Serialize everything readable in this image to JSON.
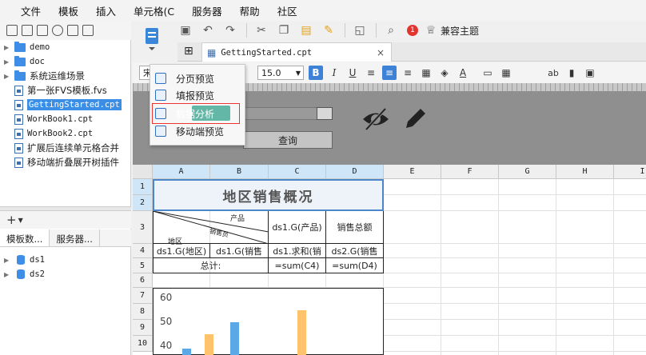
{
  "menu": [
    "文件",
    "模板",
    "插入",
    "单元格(C",
    "服务器",
    "帮助",
    "社区"
  ],
  "left_panel": {
    "tree": [
      {
        "label": "demo",
        "kind": "folder"
      },
      {
        "label": "doc",
        "kind": "folder"
      },
      {
        "label": "系统运维场景",
        "kind": "folder"
      },
      {
        "label": "第一张FVS模板.fvs",
        "kind": "file"
      },
      {
        "label": "GettingStarted.cpt",
        "kind": "file",
        "selected": true
      },
      {
        "label": "WorkBook1.cpt",
        "kind": "file"
      },
      {
        "label": "WorkBook2.cpt",
        "kind": "file"
      },
      {
        "label": "扩展后连续单元格合并",
        "kind": "file"
      },
      {
        "label": "移动端折叠展开树插件",
        "kind": "file"
      }
    ],
    "add_label": "+",
    "tabs": [
      "模板数...",
      "服务器..."
    ],
    "datasets": [
      "ds1",
      "ds2"
    ]
  },
  "toolbar": {
    "badge_count": "1",
    "theme_label": "兼容主题"
  },
  "doc_tab": {
    "label": "GettingStarted.cpt",
    "close": "×"
  },
  "format_bar": {
    "font_name": "宋",
    "font_size": "15.0",
    "bold": "B",
    "text_ab": "ab"
  },
  "preview_menu": {
    "items": [
      "分页预览",
      "填报预览",
      "数据分析",
      "移动端预览"
    ],
    "highlighted": "数据分析"
  },
  "parameter_panel": {
    "query_button": "查询"
  },
  "sheet": {
    "columns": [
      "A",
      "B",
      "C",
      "D",
      "E",
      "F",
      "G",
      "H",
      "I"
    ],
    "rows": [
      "1",
      "2",
      "3",
      "4",
      "5",
      "6",
      "7",
      "8",
      "9",
      "10"
    ],
    "title": "地区销售概况",
    "header_product": "产品",
    "header_salesman": "销售员",
    "header_region": "地区",
    "c3": "ds1.G(产品)",
    "d3": "销售总额",
    "a4": "ds1.G(地区)",
    "b4": "ds1.G(销售",
    "c4": "ds1.求和(销",
    "d4": "ds2.G(销售",
    "ab5": "总计:",
    "c5": "=sum(C4)",
    "d5": "=sum(D4)"
  },
  "chart_data": {
    "type": "bar",
    "y_ticks": [
      60,
      50,
      40
    ],
    "series": [
      {
        "color": "#5aa9e6",
        "values": [
          39,
          50
        ]
      },
      {
        "color": "#ffc46b",
        "values": [
          45,
          55
        ]
      }
    ]
  }
}
